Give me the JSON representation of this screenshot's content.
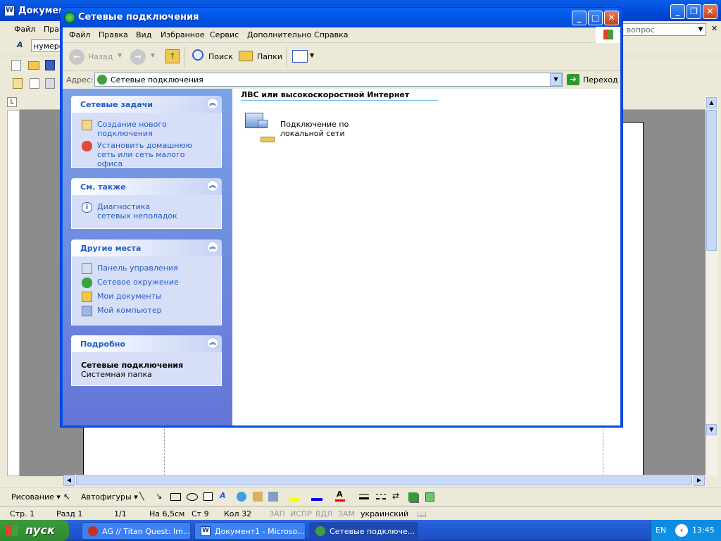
{
  "word": {
    "title": "Документ",
    "menu": [
      "Файл",
      "Прав"
    ],
    "ask_placeholder": "те вопрос",
    "style_box": "нумеро"
  },
  "explorer": {
    "title": "Сетевые подключения",
    "menu": [
      "Файл",
      "Правка",
      "Вид",
      "Избранное",
      "Сервис",
      "Дополнительно",
      "Справка"
    ],
    "toolbar": {
      "back": "Назад",
      "search": "Поиск",
      "folders": "Папки"
    },
    "address": {
      "label": "Адрес:",
      "value": "Сетевые подключения",
      "go": "Переход"
    },
    "panels": [
      {
        "title": "Сетевые задачи",
        "items": [
          "Создание нового подключения",
          "Установить домашнюю сеть или сеть малого офиса"
        ]
      },
      {
        "title": "См. также",
        "items": [
          "Диагностика сетевых неполадок"
        ]
      },
      {
        "title": "Другие места",
        "items": [
          "Панель управления",
          "Сетевое окружение",
          "Мои документы",
          "Мой компьютер"
        ]
      },
      {
        "title": "Подробно",
        "detail_title": "Сетевые подключения",
        "detail_sub": "Системная папка"
      }
    ],
    "group_header": "ЛВС или высокоскоростной Интернет",
    "connection": "Подключение по локальной сети"
  },
  "status_bar": {
    "page": "Стр.  1",
    "section": "Разд  1",
    "pages": "1/1",
    "at": "На 6,5см",
    "line": "Ст  9",
    "col": "Кол  32",
    "rec": "ЗАП",
    "trk": "ИСПР",
    "ext": "ВДЛ",
    "ovr": "ЗАМ",
    "lang": "украинский"
  },
  "draw_toolbar": {
    "draw": "Рисование ▾",
    "autoshapes": "Автофигуры ▾"
  },
  "taskbar": {
    "start": "пуск",
    "tasks": [
      "AG // Titan Quest: Im...",
      "Документ1 - Microso...",
      "Сетевые подключе..."
    ],
    "lang": "EN",
    "clock": "13:45"
  }
}
